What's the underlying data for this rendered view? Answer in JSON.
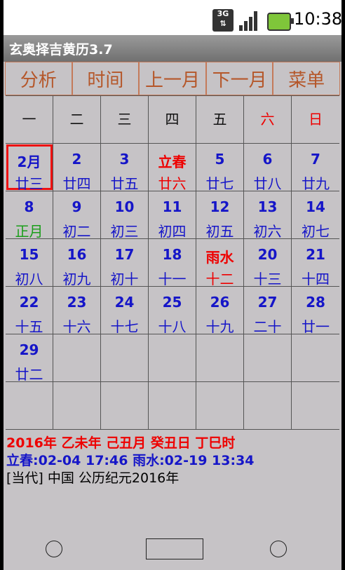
{
  "status": {
    "network": "3G",
    "time": "10:38"
  },
  "app": {
    "title": "玄奥择吉黄历3.7"
  },
  "toolbar": {
    "buttons": [
      "分析",
      "时间",
      "上一月",
      "下一月",
      "菜单"
    ]
  },
  "weekdays": [
    "一",
    "二",
    "三",
    "四",
    "五",
    "六",
    "日"
  ],
  "weeks": [
    [
      {
        "d": "2月",
        "l": "廿三",
        "today": true
      },
      {
        "d": "2",
        "l": "廿四"
      },
      {
        "d": "3",
        "l": "廿五"
      },
      {
        "d": "立春",
        "l": "廿六",
        "red": true
      },
      {
        "d": "5",
        "l": "廿七"
      },
      {
        "d": "6",
        "l": "廿八"
      },
      {
        "d": "7",
        "l": "廿九"
      }
    ],
    [
      {
        "d": "8",
        "l": "正月",
        "green": true
      },
      {
        "d": "9",
        "l": "初二"
      },
      {
        "d": "10",
        "l": "初三"
      },
      {
        "d": "11",
        "l": "初四"
      },
      {
        "d": "12",
        "l": "初五"
      },
      {
        "d": "13",
        "l": "初六"
      },
      {
        "d": "14",
        "l": "初七"
      }
    ],
    [
      {
        "d": "15",
        "l": "初八"
      },
      {
        "d": "16",
        "l": "初九"
      },
      {
        "d": "17",
        "l": "初十"
      },
      {
        "d": "18",
        "l": "十一"
      },
      {
        "d": "雨水",
        "l": "十二",
        "red": true
      },
      {
        "d": "20",
        "l": "十三"
      },
      {
        "d": "21",
        "l": "十四"
      }
    ],
    [
      {
        "d": "22",
        "l": "十五"
      },
      {
        "d": "23",
        "l": "十六"
      },
      {
        "d": "24",
        "l": "十七"
      },
      {
        "d": "25",
        "l": "十八"
      },
      {
        "d": "26",
        "l": "十九"
      },
      {
        "d": "27",
        "l": "二十"
      },
      {
        "d": "28",
        "l": "廿一"
      }
    ],
    [
      {
        "d": "29",
        "l": "廿二"
      },
      {},
      {},
      {},
      {},
      {},
      {}
    ],
    [
      {},
      {},
      {},
      {},
      {},
      {},
      {}
    ]
  ],
  "info": {
    "line1": "2016年 乙未年 己丑月 癸丑日 丁巳时",
    "line2": "立春:02-04 17:46  雨水:02-19 13:34",
    "line3": "[当代] 中国  公历纪元2016年"
  }
}
